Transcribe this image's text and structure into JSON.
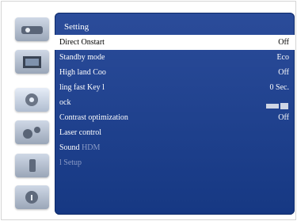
{
  "menu": {
    "title": "Setting",
    "items": [
      {
        "label": "Direct Onstart",
        "value": "Off"
      },
      {
        "label": "Standby mode",
        "value": "Eco"
      },
      {
        "label": "High land  Coo",
        "value": "Off"
      },
      {
        "label": "ling fast  Key l",
        "value": "0 Sec."
      },
      {
        "label": "ock",
        "value": ""
      },
      {
        "label": "Contrast optimization",
        "value": "Off"
      },
      {
        "label": "Laser control",
        "value": ""
      },
      {
        "label": "Sound",
        "suffix": "HDM",
        "value": ""
      },
      {
        "label": "l Setup",
        "value": ""
      }
    ]
  },
  "sidebar": {
    "icons": [
      "projector-icon",
      "image-icon",
      "gear-icon",
      "settings-gears-icon",
      "usb-icon",
      "info-icon"
    ]
  },
  "colors": {
    "panel": "#1b3d8c",
    "selected_row": "#ffffff",
    "dim_text": "#8b9bc6"
  }
}
